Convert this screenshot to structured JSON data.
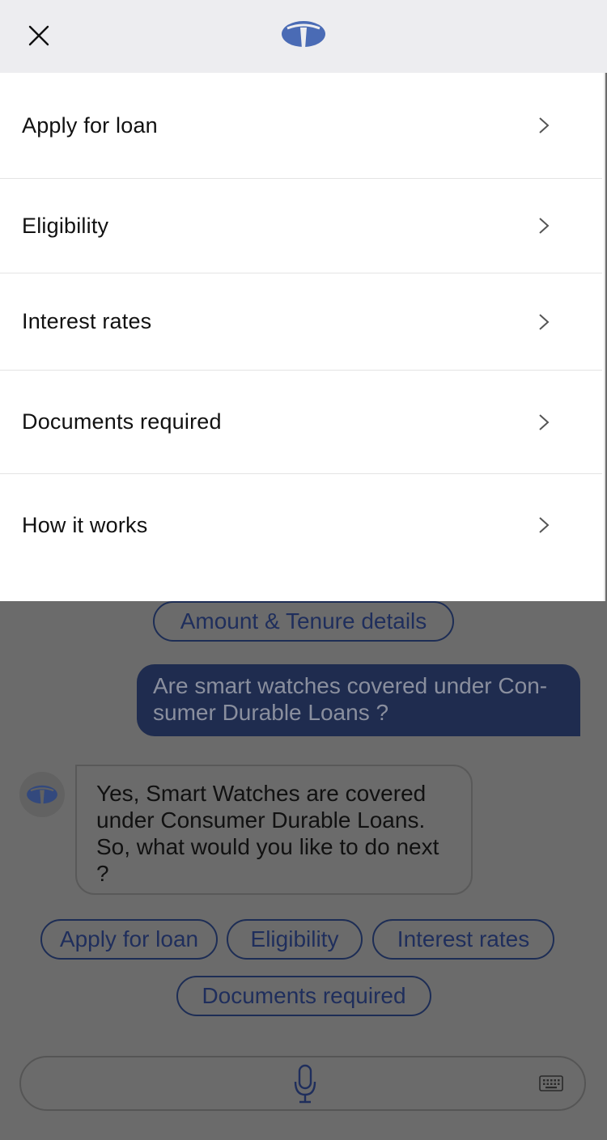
{
  "header": {
    "close_icon": "close-icon",
    "logo": "brand-logo",
    "logo_color": "#4a6bb5"
  },
  "menu": {
    "items": [
      {
        "label": "Apply for loan"
      },
      {
        "label": "Eligibility"
      },
      {
        "label": "Interest rates"
      },
      {
        "label": "Documents required"
      },
      {
        "label": "How it works"
      }
    ],
    "chevron_icon": "chevron-right-icon"
  },
  "chat": {
    "top_chip": "Amount & Tenure details",
    "user_message": "Are smart watches covered under Con-sumer Durable Loans ?",
    "user_message_lines": [
      "Are smart watches covered under Con-",
      "sumer Durable Loans ?"
    ],
    "bot_message_lines": [
      "Yes, Smart Watches are covered",
      "under Consumer Durable Loans.",
      "So, what would you like to do next",
      "?"
    ],
    "quick_replies": [
      {
        "label": "Apply for loan"
      },
      {
        "label": "Eligibility"
      },
      {
        "label": "Interest rates"
      },
      {
        "label": "Documents required"
      }
    ]
  },
  "composer": {
    "mic_icon": "microphone-icon",
    "keyboard_icon": "keyboard-icon"
  },
  "colors": {
    "overlay": "#6b6b6b",
    "brand_dark": "#1f2c4f",
    "brand_blue": "#4a6bb5",
    "header_bg": "#ededf0"
  }
}
